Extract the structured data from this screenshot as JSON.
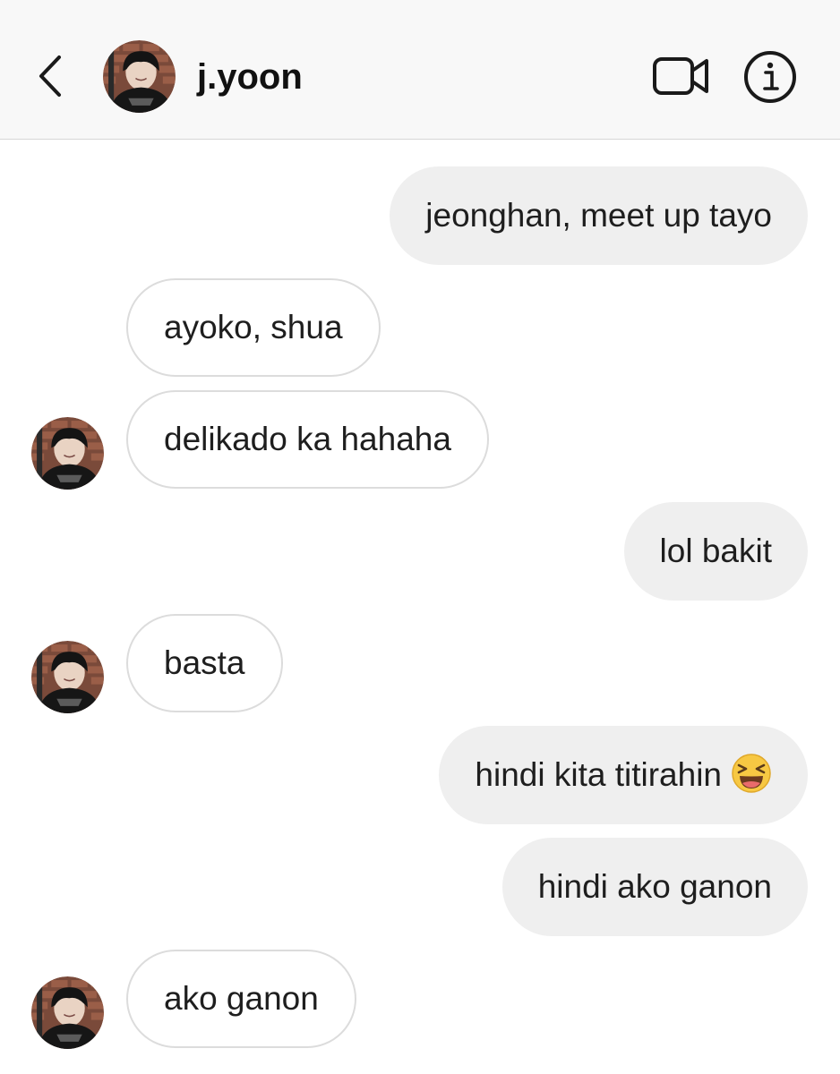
{
  "header": {
    "username": "j.yoon",
    "back_icon": "chevron-left-icon",
    "video_icon": "video-camera-icon",
    "info_icon": "info-icon"
  },
  "messages": [
    {
      "direction": "outgoing",
      "text": "jeonghan, meet up tayo"
    },
    {
      "direction": "incoming",
      "text": "ayoko, shua"
    },
    {
      "direction": "incoming",
      "text": "delikado ka hahaha"
    },
    {
      "direction": "outgoing",
      "text": "lol bakit"
    },
    {
      "direction": "incoming",
      "text": "basta"
    },
    {
      "direction": "outgoing",
      "text": "hindi kita titirahin",
      "emoji": "laughing-squint-face"
    },
    {
      "direction": "outgoing",
      "text": "hindi ako ganon"
    },
    {
      "direction": "incoming",
      "text": "ako ganon"
    }
  ],
  "colors": {
    "outgoing_bubble": "#efefef",
    "incoming_border": "#dcdcdc",
    "header_bg": "#f8f8f8"
  }
}
